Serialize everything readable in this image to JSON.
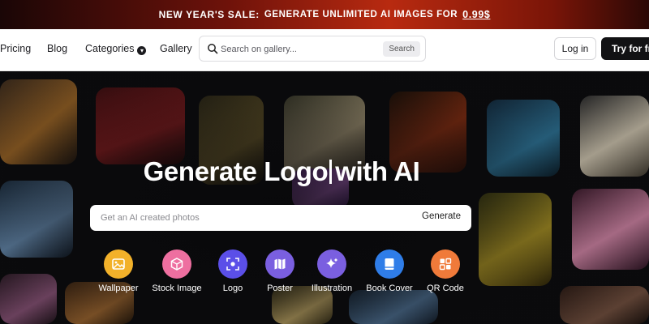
{
  "promo": {
    "lead": "NEW YEAR'S SALE:",
    "middle": "GENERATE UNLIMITED AI IMAGES FOR",
    "price": "0.99$"
  },
  "nav": {
    "links": [
      "Pricing",
      "Blog",
      "Categories",
      "Gallery"
    ],
    "search_placeholder": "Search on gallery...",
    "search_button": "Search",
    "login": "Log in",
    "try": "Try for free"
  },
  "hero": {
    "title_left": "Generate Logo",
    "title_right": "with AI",
    "input_placeholder": "Get an AI created photos",
    "generate_button": "Generate"
  },
  "categories": [
    {
      "label": "Wallpaper",
      "color": "#f2b12a",
      "icon": "image-icon"
    },
    {
      "label": "Stock Image",
      "color": "#ee6fa0",
      "icon": "cube-icon"
    },
    {
      "label": "Logo",
      "color": "#5b4fe8",
      "icon": "scan-icon"
    },
    {
      "label": "Poster",
      "color": "#7a5fe0",
      "icon": "map-icon"
    },
    {
      "label": "Illustration",
      "color": "#7a5fe0",
      "icon": "sparkle-icon"
    },
    {
      "label": "Book Cover",
      "color": "#2f7de8",
      "icon": "book-icon"
    },
    {
      "label": "QR Code",
      "color": "#f07a3a",
      "icon": "grid-icon"
    }
  ],
  "colors": {
    "accent_dark": "#121214",
    "banner_red": "#b82a10"
  }
}
